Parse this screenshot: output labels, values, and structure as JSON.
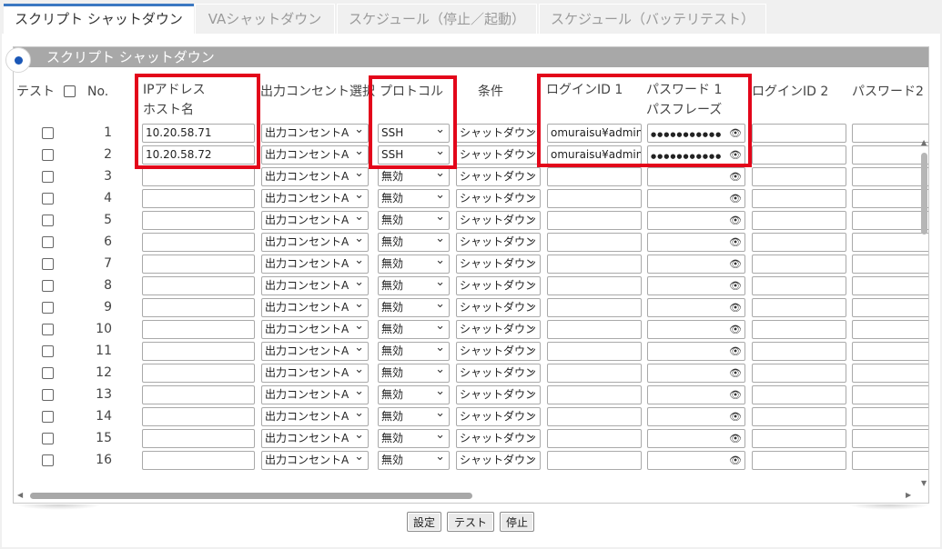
{
  "tabs": [
    {
      "label": "スクリプト シャットダウン",
      "active": true
    },
    {
      "label": "VAシャットダウン",
      "active": false
    },
    {
      "label": "スケジュール（停止／起動）",
      "active": false
    },
    {
      "label": "スケジュール（バッテリテスト）",
      "active": false
    }
  ],
  "section": {
    "title": "スクリプト シャットダウン"
  },
  "headers": {
    "test": "テスト",
    "no": "No.",
    "ip_line1": "IPアドレス",
    "ip_line2": "ホスト名",
    "outlet": "出力コンセント選択",
    "protocol": "プロトコル",
    "condition": "条件",
    "login1": "ログインID 1",
    "pw1_line1": "パスワード 1",
    "pw1_line2": "パスフレーズ",
    "login2": "ログインID 2",
    "pw2": "パスワード2"
  },
  "rows": [
    {
      "no": "1",
      "ip": "10.20.58.71",
      "outlet": "出力コンセントA",
      "protocol": "SSH",
      "condition": "シャットダウン",
      "login1": "omuraisu¥admini",
      "pw1": "●●●●●●●●●●●"
    },
    {
      "no": "2",
      "ip": "10.20.58.72",
      "outlet": "出力コンセントA",
      "protocol": "SSH",
      "condition": "シャットダウン",
      "login1": "omuraisu¥admini",
      "pw1": "●●●●●●●●●●●"
    },
    {
      "no": "3",
      "ip": "",
      "outlet": "出力コンセントA",
      "protocol": "無効",
      "condition": "シャットダウン",
      "login1": "",
      "pw1": ""
    },
    {
      "no": "4",
      "ip": "",
      "outlet": "出力コンセントA",
      "protocol": "無効",
      "condition": "シャットダウン",
      "login1": "",
      "pw1": ""
    },
    {
      "no": "5",
      "ip": "",
      "outlet": "出力コンセントA",
      "protocol": "無効",
      "condition": "シャットダウン",
      "login1": "",
      "pw1": ""
    },
    {
      "no": "6",
      "ip": "",
      "outlet": "出力コンセントA",
      "protocol": "無効",
      "condition": "シャットダウン",
      "login1": "",
      "pw1": ""
    },
    {
      "no": "7",
      "ip": "",
      "outlet": "出力コンセントA",
      "protocol": "無効",
      "condition": "シャットダウン",
      "login1": "",
      "pw1": ""
    },
    {
      "no": "8",
      "ip": "",
      "outlet": "出力コンセントA",
      "protocol": "無効",
      "condition": "シャットダウン",
      "login1": "",
      "pw1": ""
    },
    {
      "no": "9",
      "ip": "",
      "outlet": "出力コンセントA",
      "protocol": "無効",
      "condition": "シャットダウン",
      "login1": "",
      "pw1": ""
    },
    {
      "no": "10",
      "ip": "",
      "outlet": "出力コンセントA",
      "protocol": "無効",
      "condition": "シャットダウン",
      "login1": "",
      "pw1": ""
    },
    {
      "no": "11",
      "ip": "",
      "outlet": "出力コンセントA",
      "protocol": "無効",
      "condition": "シャットダウン",
      "login1": "",
      "pw1": ""
    },
    {
      "no": "12",
      "ip": "",
      "outlet": "出力コンセントA",
      "protocol": "無効",
      "condition": "シャットダウン",
      "login1": "",
      "pw1": ""
    },
    {
      "no": "13",
      "ip": "",
      "outlet": "出力コンセントA",
      "protocol": "無効",
      "condition": "シャットダウン",
      "login1": "",
      "pw1": ""
    },
    {
      "no": "14",
      "ip": "",
      "outlet": "出力コンセントA",
      "protocol": "無効",
      "condition": "シャットダウン",
      "login1": "",
      "pw1": ""
    },
    {
      "no": "15",
      "ip": "",
      "outlet": "出力コンセントA",
      "protocol": "無効",
      "condition": "シャットダウン",
      "login1": "",
      "pw1": ""
    },
    {
      "no": "16",
      "ip": "",
      "outlet": "出力コンセントA",
      "protocol": "無効",
      "condition": "シャットダウン",
      "login1": "",
      "pw1": ""
    }
  ],
  "buttons": {
    "set": "設定",
    "test": "テスト",
    "stop": "停止"
  },
  "colors": {
    "accent": "#3b78c2",
    "highlight": "#e3061a",
    "section_bar": "#a8a8a8"
  },
  "icons": {
    "password_reveal": "eye-icon",
    "select": "chevron-down-icon"
  }
}
